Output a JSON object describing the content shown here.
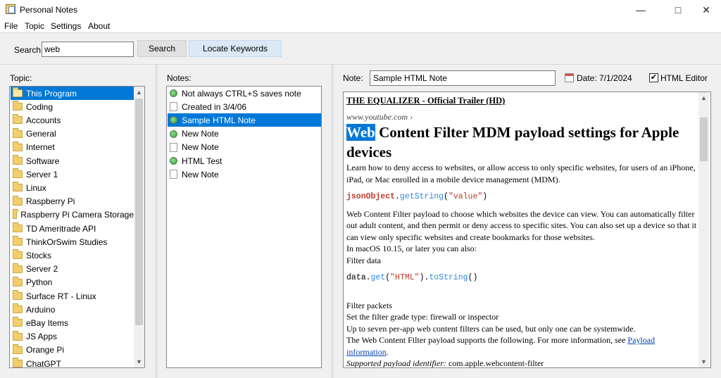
{
  "window": {
    "title": "Personal Notes"
  },
  "menu": {
    "file": "File",
    "topic": "Topic",
    "settings": "Settings",
    "about": "About"
  },
  "toolbar": {
    "search_label": "Search:",
    "search_value": "web",
    "search_button": "Search",
    "locate_button": "Locate Keywords"
  },
  "topics": {
    "label": "Topic:",
    "items": [
      "This Program",
      "Coding",
      "Accounts",
      "General",
      "Internet",
      "Software",
      "Server 1",
      "Linux",
      "Raspberry Pi",
      "Raspberry Pi Camera Storage",
      "TD Ameritrade API",
      "ThinkOrSwim Studies",
      "Stocks",
      "Server 2",
      "Python",
      "Surface RT - Linux",
      "Arduino",
      "eBay Items",
      "JS Apps",
      "Orange Pi",
      "ChatGPT"
    ],
    "selected": "This Program"
  },
  "notes": {
    "label": "Notes:",
    "items": [
      {
        "title": "Not always CTRL+S saves note",
        "icon": "globe-icon"
      },
      {
        "title": "Created in 3/4/06",
        "icon": "document-icon"
      },
      {
        "title": "Sample HTML Note",
        "icon": "globe-icon"
      },
      {
        "title": "New Note",
        "icon": "globe-icon"
      },
      {
        "title": "New Note",
        "icon": "document-icon"
      },
      {
        "title": "HTML Test",
        "icon": "globe-icon"
      },
      {
        "title": "New Note",
        "icon": "document-icon"
      }
    ],
    "selected": "Sample HTML Note"
  },
  "note": {
    "label": "Note:",
    "title_value": "Sample HTML Note",
    "date_text": "Date: 7/1/2024",
    "html_editor_label": "HTML Editor",
    "html_editor_checked": true
  },
  "content": {
    "link_title": "THE EQUALIZER - Official Trailer (HD)",
    "source": "www.youtube.com ›",
    "heading_highlight": "Web",
    "heading_rest": " Content Filter MDM payload settings for Apple devices",
    "p1": "Learn how to deny access to websites, or allow access to only specific websites, for users of an iPhone, iPad, or Mac enrolled in a mobile device management (MDM).",
    "code1_obj": "jsonObject",
    "code1_dot": ".",
    "code1_fn": "getString",
    "code1_open": "(",
    "code1_str": "\"value\"",
    "code1_close": ")",
    "p2": "Web Content Filter payload to choose which websites the device can view. You can automatically filter out adult content, and then permit or deny access to specific sites. You can also set up a device so that it can view only specific websites and create bookmarks for those websites.",
    "p3": "In macOS 10.15, or later you can also:",
    "p4": "Filter data",
    "code2_obj": "data",
    "code2_dot1": ".",
    "code2_fn1": "get",
    "code2_open1": "(",
    "code2_str": "\"HTML\"",
    "code2_close1": ")",
    "code2_dot2": ".",
    "code2_fn2": "toString",
    "code2_paren": "()",
    "p5": "Filter packets",
    "p6": "Set the filter grade type: firewall or inspector",
    "p7": "Up to seven per-app web content filters can be used, but only one can be systemwide.",
    "p8_text": "The Web Content Filter payload supports the following. For more information, see ",
    "p8_link": "Payload information",
    "p8_end": ".",
    "p9_label": "Supported payload identifier:",
    "p9_value": " com.apple.webcontent-filter"
  },
  "colors": {
    "selection": "#0078d7",
    "keyword": "#c0392b",
    "function": "#2e86de",
    "link": "#0645ad"
  }
}
